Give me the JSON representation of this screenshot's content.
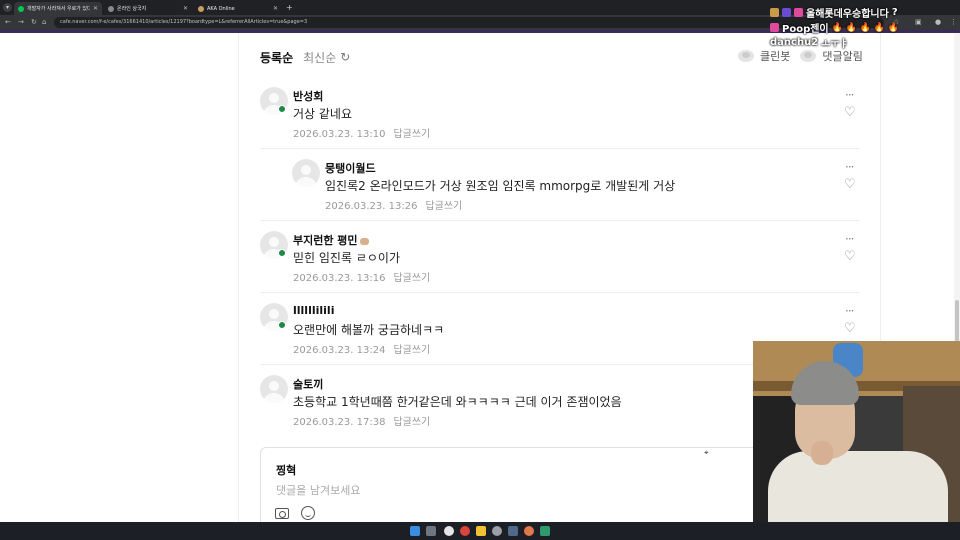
{
  "browser": {
    "tabs": [
      {
        "title": "개발자가 사라져서 우로가 있다"
      },
      {
        "title": "온라인 상국지"
      },
      {
        "title": "AKA Online"
      }
    ],
    "url": "cafe.naver.com/f-e/cafes/31661410/articles/12197?boardtype=L&referrerAllArticles=true&page=3"
  },
  "sort": {
    "active": "등록순",
    "inactive": "최신순"
  },
  "toolbar": {
    "cleanbot": "클린봇",
    "notify": "댓글알림"
  },
  "comments": [
    {
      "nick": "반성회",
      "text": "거상 같네요",
      "date": "2026.03.23. 13:10",
      "reply": "답글쓰기"
    },
    {
      "nick": "뭉탱이월드",
      "text": "임진록2 온라인모드가 거상 원조임 임진록 mmorpg로 개발된게 거상",
      "date": "2026.03.23. 13:26",
      "reply": "답글쓰기"
    },
    {
      "nick": "부지런한 평민",
      "text": "믿힌 임진록 ㄹㅇ이가",
      "date": "2026.03.23. 13:16",
      "reply": "답글쓰기"
    },
    {
      "nick": "llllllilili",
      "text": "오랜만에 해볼까 궁금하네ㅋㅋ",
      "date": "2026.03.23. 13:24",
      "reply": "답글쓰기"
    },
    {
      "nick": "술토끼",
      "text": "초등학교 1학년때쯤 한거같은데 와ㅋㅋㅋㅋ 근데 이거 존잼이었음",
      "date": "2026.03.23. 17:38",
      "reply": "답글쓰기"
    }
  ],
  "reply_box": {
    "nick": "찡혁",
    "placeholder": "댓글을 남겨보세요"
  },
  "chat": [
    {
      "name": "올해롯데우승합니다",
      "msg": "?"
    },
    {
      "name": "Poop젠이",
      "msg": "🔥 🔥 🔥 🔥 🔥"
    },
    {
      "name": "danchu2",
      "msg": "ㅗㅜㅑ"
    }
  ],
  "icons": {
    "more": "more-icon",
    "like": "heart-icon",
    "refresh": "refresh-icon",
    "camera": "camera-icon",
    "emoji": "emoji-icon"
  }
}
